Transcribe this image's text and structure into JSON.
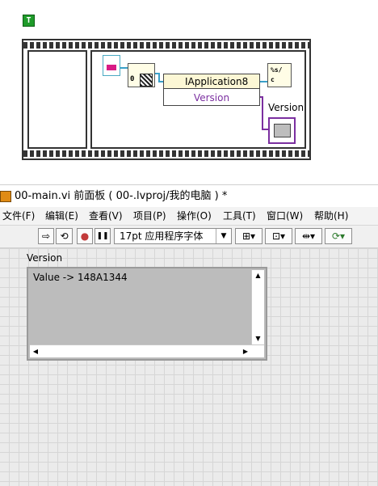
{
  "block_diagram": {
    "bool_constant": "T",
    "property_node_class": "IApplication8",
    "property_node_property": "Version",
    "open_node_terminal": "0",
    "output_node_glyph": "%s/\nc",
    "indicator_label": "Version"
  },
  "window": {
    "title": "00-main.vi 前面板 ( 00-.lvproj/我的电脑 ) *"
  },
  "menu": {
    "items": [
      "文件(F)",
      "编辑(E)",
      "查看(V)",
      "项目(P)",
      "操作(O)",
      "工具(T)",
      "窗口(W)",
      "帮助(H)"
    ]
  },
  "toolbar": {
    "run_icon": "⇨",
    "run_continuous_icon": "⟲",
    "abort_icon": "●",
    "pause_icon": "❚❚",
    "font_setting": "17pt 应用程序字体",
    "font_dropdown_icon": "▼",
    "align_icon": "⊞▾",
    "distribute_icon": "⊡▾",
    "resize_icon": "⇹▾",
    "reorder_icon": "⟳▾"
  },
  "front_panel": {
    "indicator_label": "Version",
    "indicator_value": "Value -> 148A1344"
  },
  "colors": {
    "wire_refnum": "#3aa0c8",
    "wire_string": "#7b2fa0",
    "bool_constant": "#1f9b2a",
    "title_icon": "#e08b14"
  }
}
